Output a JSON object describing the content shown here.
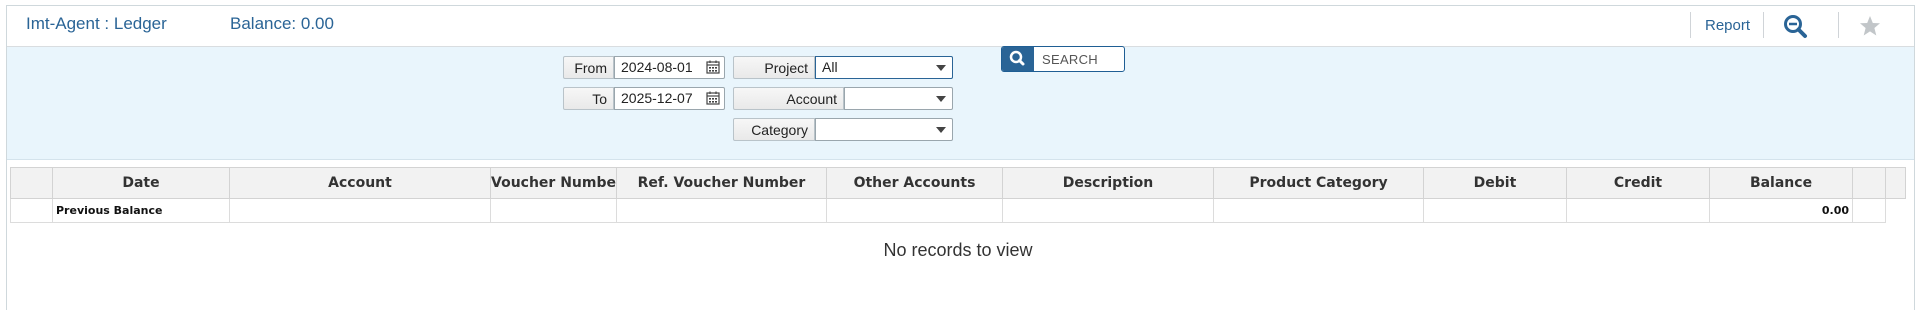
{
  "header": {
    "title": "Imt-Agent : Ledger",
    "balance": "Balance: 0.00",
    "report_label": "Report"
  },
  "filters": {
    "from_label": "From",
    "from_value": "2024-08-01",
    "to_label": "To",
    "to_value": "2025-12-07",
    "project_label": "Project",
    "project_value": "All",
    "account_label": "Account",
    "account_value": "",
    "category_label": "Category",
    "category_value": "",
    "search_label": "SEARCH"
  },
  "grid": {
    "columns": [
      "Date",
      "Account",
      "Voucher Number",
      "Ref. Voucher Number",
      "Other Accounts",
      "Description",
      "Product Category",
      "Debit",
      "Credit",
      "Balance"
    ],
    "previous_balance_label": "Previous Balance",
    "previous_balance_value": "0.00",
    "empty_message": "No records to view"
  },
  "colors": {
    "accent": "#2a6496",
    "filter_bg": "#e9f5fc",
    "header_bg": "#f2f2f2"
  }
}
